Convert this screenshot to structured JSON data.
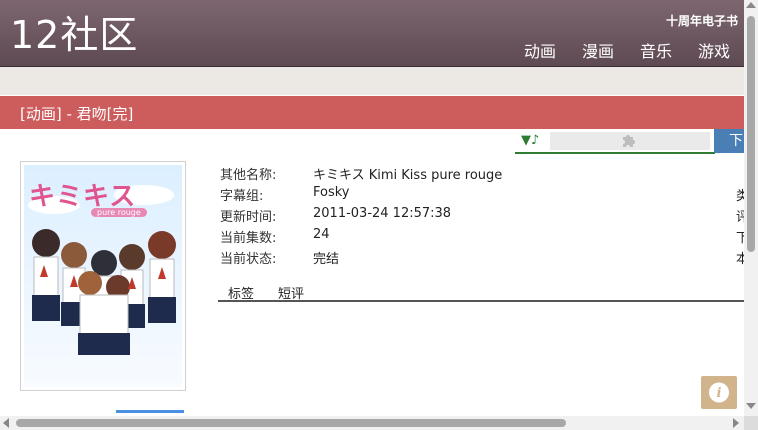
{
  "site": {
    "logo": "12社区",
    "top_link": "十周年电子书"
  },
  "nav": {
    "items": [
      "动画",
      "漫画",
      "音乐",
      "游戏"
    ]
  },
  "page": {
    "title": "[动画] - 君吻[完]"
  },
  "player": {
    "toggle": "▼♪",
    "plugin_icon": "puzzle-icon"
  },
  "download_button": {
    "label": "下"
  },
  "cover": {
    "title": "キミキス",
    "subtitle": "pure rouge"
  },
  "info": {
    "rows": [
      {
        "label": "其他名称:",
        "value": "キミキス Kimi Kiss pure rouge",
        "edge": ""
      },
      {
        "label": "字幕组:",
        "value": "Fosky",
        "edge": "类"
      },
      {
        "label": "更新时间:",
        "value": "2011-03-24 12:57:38",
        "edge": "评"
      },
      {
        "label": "当前集数:",
        "value": "24",
        "edge": "下"
      },
      {
        "label": "当前状态:",
        "value": "完结",
        "edge": "本"
      }
    ]
  },
  "tabs": [
    "标签",
    "短评"
  ],
  "info_button": {
    "icon": "info-icon",
    "glyph": "i"
  },
  "colors": {
    "header": "#6e5a62",
    "title_bar": "#cd5c5c",
    "player_line": "#2e7d32",
    "download": "#4a7fb5",
    "info_button": "#d2b48c"
  }
}
